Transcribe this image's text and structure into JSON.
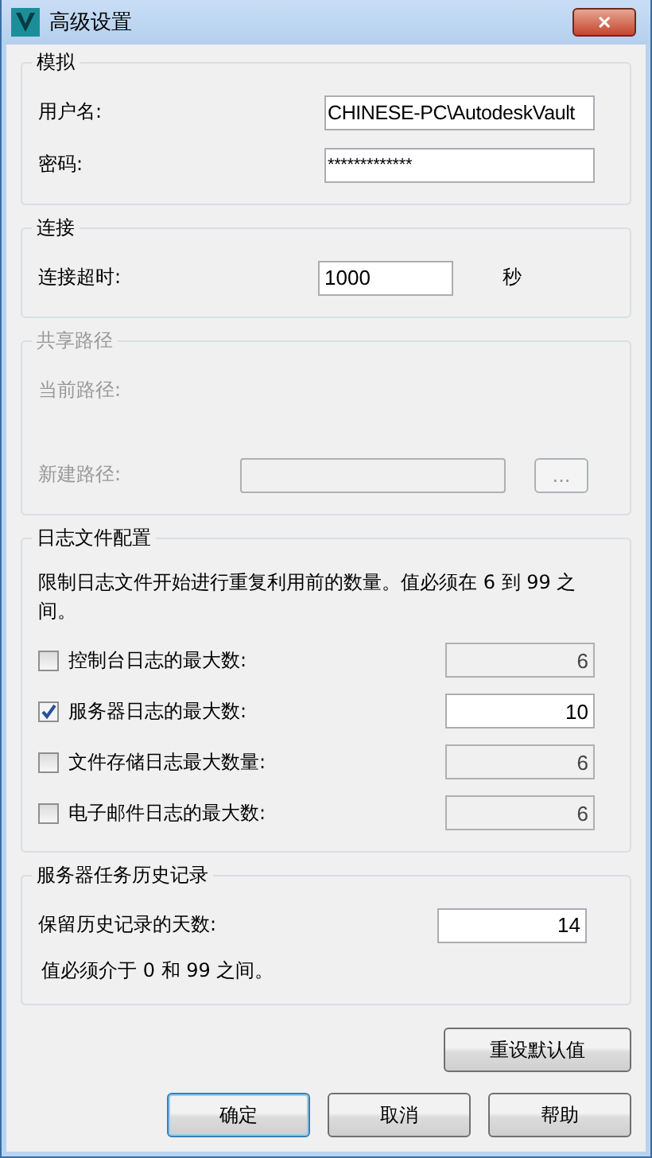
{
  "window": {
    "title": "高级设置",
    "close": "✕"
  },
  "impersonation": {
    "title": "模拟",
    "username_label": "用户名:",
    "username": "CHINESE-PC\\AutodeskVault",
    "password_label": "密码:",
    "password": "*************"
  },
  "connection": {
    "title": "连接",
    "timeout_label": "连接超时:",
    "timeout": "1000",
    "unit": "秒"
  },
  "shared_path": {
    "title": "共享路径",
    "disabled": true,
    "current_label": "当前路径:",
    "new_label": "新建路径:",
    "browse": "..."
  },
  "log_config": {
    "title": "日志文件配置",
    "description": "限制日志文件开始进行重复利用前的数量。值必须在 6 到 99 之间。",
    "rows": [
      {
        "label": "控制台日志的最大数:",
        "checked": false,
        "value": "6"
      },
      {
        "label": "服务器日志的最大数:",
        "checked": true,
        "value": "10"
      },
      {
        "label": "文件存储日志最大数量:",
        "checked": false,
        "value": "6"
      },
      {
        "label": "电子邮件日志的最大数:",
        "checked": false,
        "value": "6"
      }
    ]
  },
  "history": {
    "title": "服务器任务历史记录",
    "days_label": "保留历史记录的天数:",
    "days": "14",
    "note": "值必须介于 0 和 99 之间。"
  },
  "reset_button": "重设默认值",
  "buttons": [
    {
      "label": "确定",
      "selected": true
    },
    {
      "label": "取消",
      "selected": false
    },
    {
      "label": "帮助",
      "selected": false
    }
  ]
}
